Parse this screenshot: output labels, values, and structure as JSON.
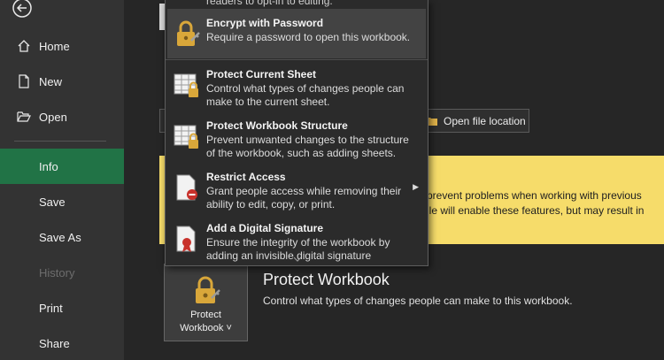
{
  "sidebar": {
    "items": [
      {
        "label": "Home",
        "icon": "home-icon"
      },
      {
        "label": "New",
        "icon": "new-file-icon"
      },
      {
        "label": "Open",
        "icon": "open-folder-icon"
      },
      {
        "label": "Info"
      },
      {
        "label": "Save"
      },
      {
        "label": "Save As"
      },
      {
        "label": "History"
      },
      {
        "label": "Print"
      },
      {
        "label": "Share"
      }
    ],
    "active": "Info"
  },
  "main": {
    "open_location_label": "Open file location",
    "banner": {
      "line1": "prevent problems when working with previous",
      "line2": "ile will enable these features, but may result in"
    },
    "protect_workbook": {
      "tile_line1": "Protect",
      "tile_line2": "Workbook ˅",
      "title": "Protect Workbook",
      "description": "Control what types of changes people can make to this workbook."
    }
  },
  "menu": {
    "cutoff_text": "readers to opt-in to editing.",
    "items": [
      {
        "title": "Encrypt with Password",
        "description": "Require a password to open this workbook."
      },
      {
        "title": "Protect Current Sheet",
        "description": "Control what types of changes people can make to the current sheet."
      },
      {
        "title": "Protect Workbook Structure",
        "description": "Prevent unwanted changes to the structure of the workbook, such as adding sheets."
      },
      {
        "title": "Restrict Access",
        "description": "Grant people access while removing their ability to edit, copy, or print."
      },
      {
        "title": "Add a Digital Signature",
        "description": "Ensure the integrity of the workbook by adding an invisible digital signature"
      }
    ]
  },
  "colors": {
    "active_nav": "#217346",
    "banner": "#f6dc6a",
    "lock": "#d9a73a"
  }
}
